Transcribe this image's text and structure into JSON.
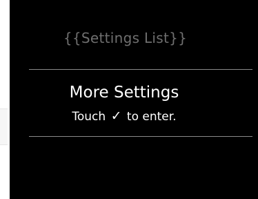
{
  "settings_list": {
    "title": "{{Settings List}}",
    "items": [
      {
        "label": "More Settings",
        "hint_before": "Touch",
        "hint_icon": "check-icon",
        "hint_icon_glyph": "✓",
        "hint_after": "to enter."
      }
    ]
  },
  "colors": {
    "background": "#000000",
    "text": "#ffffff",
    "title": "#6f6f6f",
    "divider": "#8a8a8a"
  }
}
